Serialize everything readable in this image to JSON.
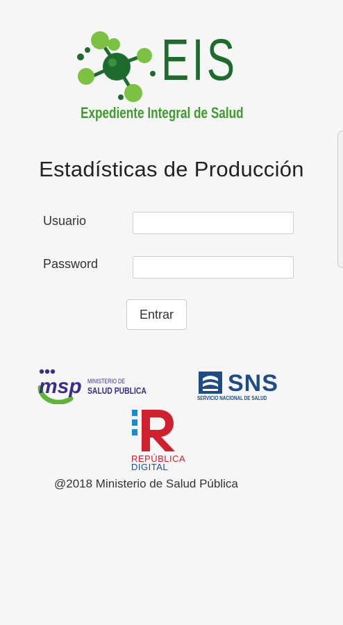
{
  "logo": {
    "letters": "EIS",
    "subtitle": "Expediente Integral de Salud",
    "icon": "molecule-icon",
    "colors": {
      "dark_green": "#1e6b2e",
      "light_green": "#7cc242"
    }
  },
  "page": {
    "title": "Estadísticas de Producción"
  },
  "form": {
    "user_label": "Usuario",
    "user_value": "",
    "password_label": "Password",
    "password_value": "",
    "submit_label": "Entrar"
  },
  "partners": {
    "msp": {
      "line1": "MINISTERIO DE",
      "line2": "SALUD PUBLICA",
      "icon": "msp-logo-icon"
    },
    "sns": {
      "name": "SNS",
      "subtitle": "SERVICIO NACIONAL DE SALUD",
      "icon": "sns-emblem-icon"
    },
    "rd": {
      "line1": "REPÚBLICA",
      "line2": "DIGITAL",
      "icon": "republica-digital-r-icon"
    }
  },
  "footer": {
    "copyright": "@2018 Ministerio de Salud Pública"
  }
}
